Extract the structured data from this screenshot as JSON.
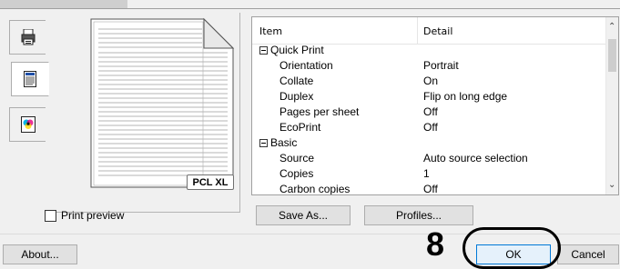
{
  "side_tabs": [
    {
      "name": "quick-print",
      "icon": "printer-icon"
    },
    {
      "name": "basic",
      "icon": "document-icon"
    },
    {
      "name": "color",
      "icon": "color-icon"
    }
  ],
  "preview": {
    "badge": "PCL XL"
  },
  "settings": {
    "headers": {
      "item": "Item",
      "detail": "Detail"
    },
    "rows": [
      {
        "type": "group",
        "label": "Quick Print"
      },
      {
        "type": "item",
        "label": "Orientation",
        "value": "Portrait"
      },
      {
        "type": "item",
        "label": "Collate",
        "value": "On"
      },
      {
        "type": "item",
        "label": "Duplex",
        "value": "Flip on long edge"
      },
      {
        "type": "item",
        "label": "Pages per sheet",
        "value": "Off"
      },
      {
        "type": "item",
        "label": "EcoPrint",
        "value": "Off"
      },
      {
        "type": "group",
        "label": "Basic"
      },
      {
        "type": "item",
        "label": "Source",
        "value": "Auto source selection"
      },
      {
        "type": "item",
        "label": "Copies",
        "value": "1"
      },
      {
        "type": "item",
        "label": "Carbon copies",
        "value": "Off"
      }
    ]
  },
  "print_preview_label": "Print preview",
  "buttons": {
    "save_as": "Save As...",
    "profiles": "Profiles...",
    "about": "About...",
    "ok": "OK",
    "cancel": "Cancel"
  },
  "annotation": {
    "step": "8"
  }
}
